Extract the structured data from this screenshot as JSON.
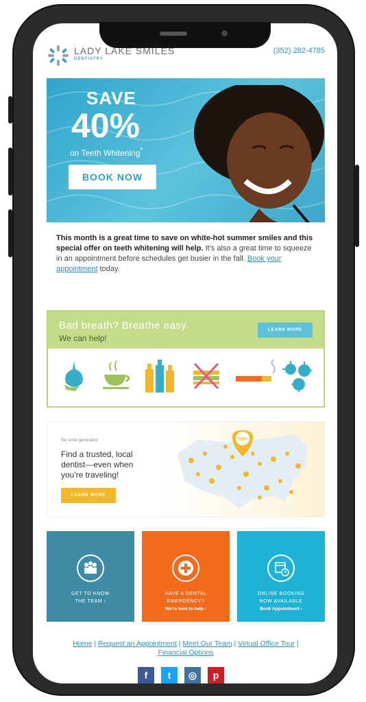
{
  "header": {
    "brand_name": "LADY LAKE SMILES",
    "brand_sub": "DENTISTRY",
    "phone": "(352) 282-4785"
  },
  "hero": {
    "save": "SAVE",
    "percent": "40%",
    "subtitle": "on Teeth Whitening",
    "asterisk": "*",
    "cta": "BOOK NOW"
  },
  "intro": {
    "bold": "This month is a great time to save on white-hot summer smiles and this special offer on teeth whitening will help.",
    "text": " It's also a great time to squeeze in an appointment before schedules get busier in the fall. ",
    "link": "Book your appointment",
    "tail": " today."
  },
  "breath": {
    "title": "Bad breath? Breathe easy.",
    "subtitle": "We can help!",
    "cta": "LEARN MORE",
    "icons": [
      "onion-icon",
      "coffee-icon",
      "bottles-icon",
      "no-food-icon",
      "cigarette-icon",
      "bacteria-icon"
    ]
  },
  "finder": {
    "brand": "the smile generation",
    "text": "Find a trusted, local dentist—even when you're traveling!",
    "cta": "LEARN MORE",
    "badge": "700+"
  },
  "tiles": [
    {
      "line1": "GET TO KNOW",
      "line2": "THE TEAM ›",
      "color": "#3d8ba5"
    },
    {
      "line1": "HAVE A DENTAL",
      "line2": "EMERGENCY?",
      "line3": "We're here to help ›",
      "color": "#f26a1b"
    },
    {
      "line1": "ONLINE BOOKING",
      "line2": "NOW AVAILABLE",
      "line3": "Book Appointment ›",
      "color": "#1eb3d6"
    }
  ],
  "footer": {
    "links": [
      "Home",
      "Request an Appointment",
      "Meet Our Team",
      "Virtual Office Tour",
      "Financial Options"
    ],
    "sep": " | "
  },
  "social": [
    {
      "icon": "facebook-icon",
      "glyph": "f",
      "color": "#3b5998"
    },
    {
      "icon": "twitter-icon",
      "glyph": "t",
      "color": "#1da1f2"
    },
    {
      "icon": "instagram-icon",
      "glyph": "◎",
      "color": "#3f729b"
    },
    {
      "icon": "pinterest-icon",
      "glyph": "p",
      "color": "#cb2027"
    }
  ]
}
